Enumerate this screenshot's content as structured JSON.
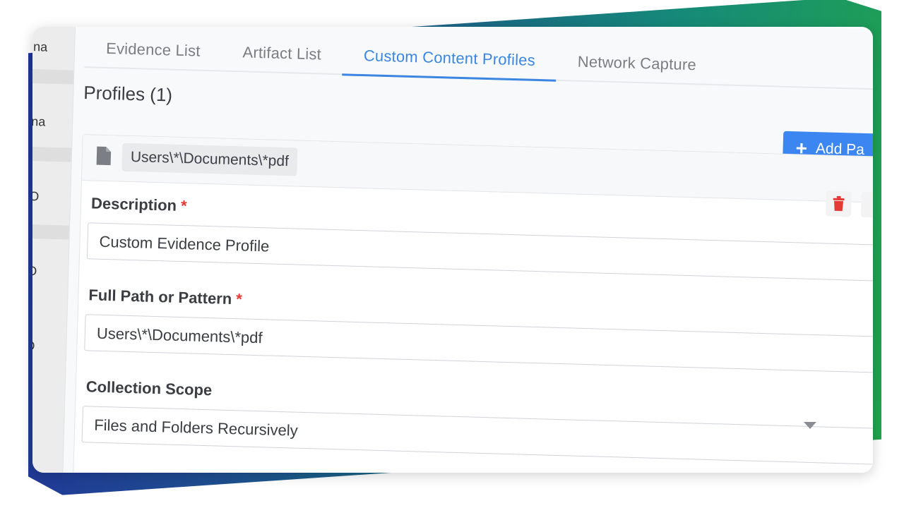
{
  "left_fragments": [
    "na",
    "na",
    "O",
    "O",
    "O"
  ],
  "tabs": [
    {
      "label": "Evidence List",
      "active": false
    },
    {
      "label": "Artifact List",
      "active": false
    },
    {
      "label": "Custom Content Profiles",
      "active": true
    },
    {
      "label": "Network Capture",
      "active": false
    }
  ],
  "profiles": {
    "title": "Profiles (1)",
    "add_button_label": "Add Pa"
  },
  "profile": {
    "path_chip": "Users\\*\\Documents\\*pdf",
    "description_label": "Description",
    "description_value": "Custom Evidence Profile",
    "path_label": "Full Path or Pattern",
    "path_value": "Users\\*\\Documents\\*pdf",
    "scope_label": "Collection Scope",
    "scope_value": "Files and Folders Recursively",
    "required_mark": "*"
  },
  "colors": {
    "accent": "#3b86e0",
    "button": "#3b86f0",
    "danger": "#e53935"
  },
  "icons": [
    "document-icon",
    "plus-icon",
    "trash-icon",
    "chevron-down-icon"
  ]
}
